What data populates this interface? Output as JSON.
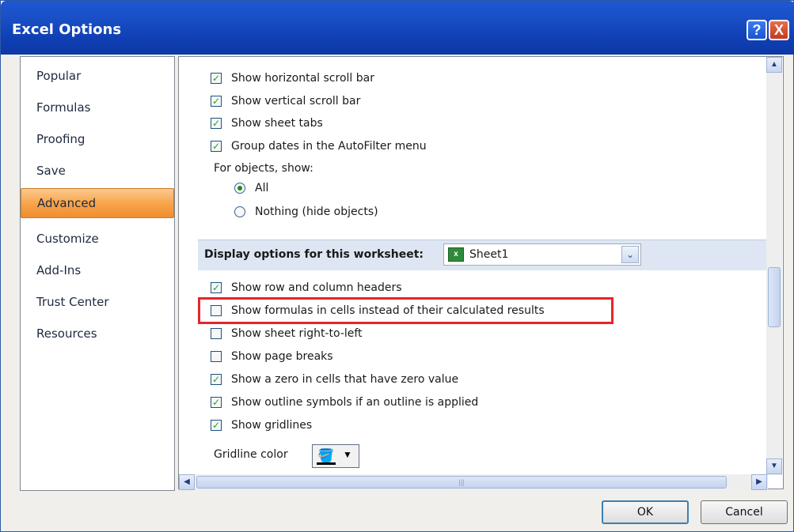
{
  "window": {
    "title": "Excel Options",
    "help_label": "?",
    "close_label": "X"
  },
  "nav": {
    "items": [
      {
        "label": "Popular",
        "active": false
      },
      {
        "label": "Formulas",
        "active": false
      },
      {
        "label": "Proofing",
        "active": false
      },
      {
        "label": "Save",
        "active": false
      },
      {
        "label": "Advanced",
        "active": true
      },
      {
        "label": "Customize",
        "active": false
      },
      {
        "label": "Add-Ins",
        "active": false
      },
      {
        "label": "Trust Center",
        "active": false
      },
      {
        "label": "Resources",
        "active": false
      }
    ]
  },
  "workbook_options": [
    {
      "label": "Show horizontal scroll bar",
      "checked": true
    },
    {
      "label": "Show vertical scroll bar",
      "checked": true
    },
    {
      "label": "Show sheet tabs",
      "checked": true
    },
    {
      "label": "Group dates in the AutoFilter menu",
      "checked": true
    }
  ],
  "objects": {
    "label": "For objects, show:",
    "options": [
      {
        "label": "All",
        "selected": true
      },
      {
        "label": "Nothing (hide objects)",
        "selected": false
      }
    ]
  },
  "worksheet_section": {
    "label": "Display options for this worksheet:",
    "selected_sheet": "Sheet1",
    "sheet_icon_text": "x",
    "arrow": "⌄"
  },
  "worksheet_options": [
    {
      "label": "Show row and column headers",
      "checked": true
    },
    {
      "label": "Show formulas in cells instead of their calculated results",
      "checked": false
    },
    {
      "label": "Show sheet right-to-left",
      "checked": false
    },
    {
      "label": "Show page breaks",
      "checked": false
    },
    {
      "label": "Show a zero in cells that have zero value",
      "checked": true
    },
    {
      "label": "Show outline symbols if an outline is applied",
      "checked": true
    },
    {
      "label": "Show gridlines",
      "checked": true
    }
  ],
  "gridline": {
    "label": "Gridline color",
    "dropdown_arrow": "▼",
    "icon": "paint-bucket-icon"
  },
  "scroll": {
    "up": "▲",
    "down": "▼",
    "left": "◀",
    "right": "▶",
    "grip": "|||"
  },
  "buttons": {
    "ok": "OK",
    "cancel": "Cancel"
  },
  "colors": {
    "highlight": "#e3262a",
    "nav_active": "#f8a54c",
    "titlebar": "#1a50c7"
  }
}
